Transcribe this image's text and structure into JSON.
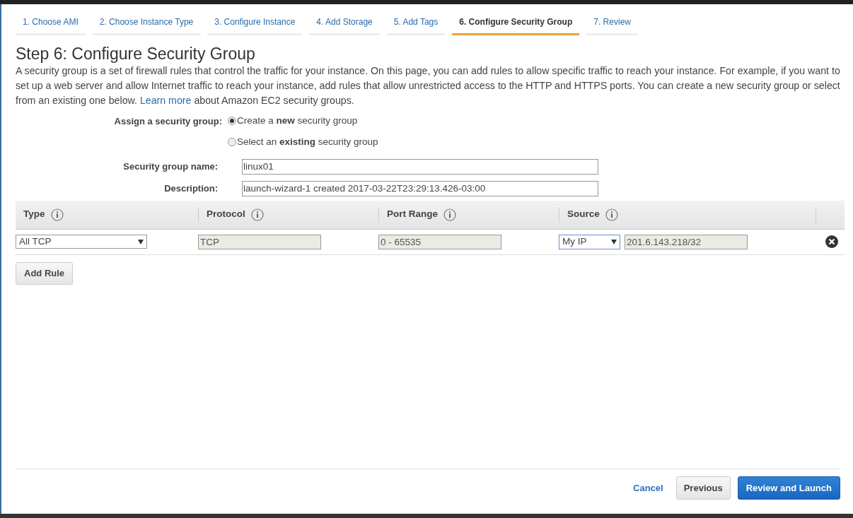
{
  "tabs": [
    {
      "label": "1. Choose AMI",
      "selected": false
    },
    {
      "label": "2. Choose Instance Type",
      "selected": false
    },
    {
      "label": "3. Configure Instance",
      "selected": false
    },
    {
      "label": "4. Add Storage",
      "selected": false
    },
    {
      "label": "5. Add Tags",
      "selected": false
    },
    {
      "label": "6. Configure Security Group",
      "selected": true
    },
    {
      "label": "7. Review",
      "selected": false
    }
  ],
  "title": "Step 6: Configure Security Group",
  "intro": {
    "text_before": "A security group is a set of firewall rules that control the traffic for your instance. On this page, you can add rules to allow specific traffic to reach your instance. For example, if you want to set up a web server and allow Internet traffic to reach your instance, add rules that allow unrestricted access to the HTTP and HTTPS ports. You can create a new security group or select from an existing one below.",
    "link": "Learn more",
    "text_after": "about Amazon EC2 security groups."
  },
  "assign": {
    "label": "Assign a security group:",
    "options": [
      {
        "label": "Create a **new** security group",
        "selected": true
      },
      {
        "label": "Select an **existing** security group",
        "selected": false
      }
    ]
  },
  "fields": [
    {
      "label": "Security group name:",
      "value": "linux01"
    },
    {
      "label": "Description:",
      "value": "launch-wizard-1 created 2017-03-22T23:29:13.426-03:00"
    }
  ],
  "table": {
    "columns": [
      "Type",
      "Protocol",
      "Port Range",
      "Source"
    ],
    "rows": [
      {
        "type": "All TCP",
        "protocol": "TCP",
        "port_range": "0 - 65535",
        "source": "My IP",
        "source_value": "201.6.143.218/32"
      }
    ]
  },
  "add_rule": "Add Rule",
  "footer": {
    "cancel": "Cancel",
    "previous": "Previous",
    "primary": "Review and Launch"
  }
}
